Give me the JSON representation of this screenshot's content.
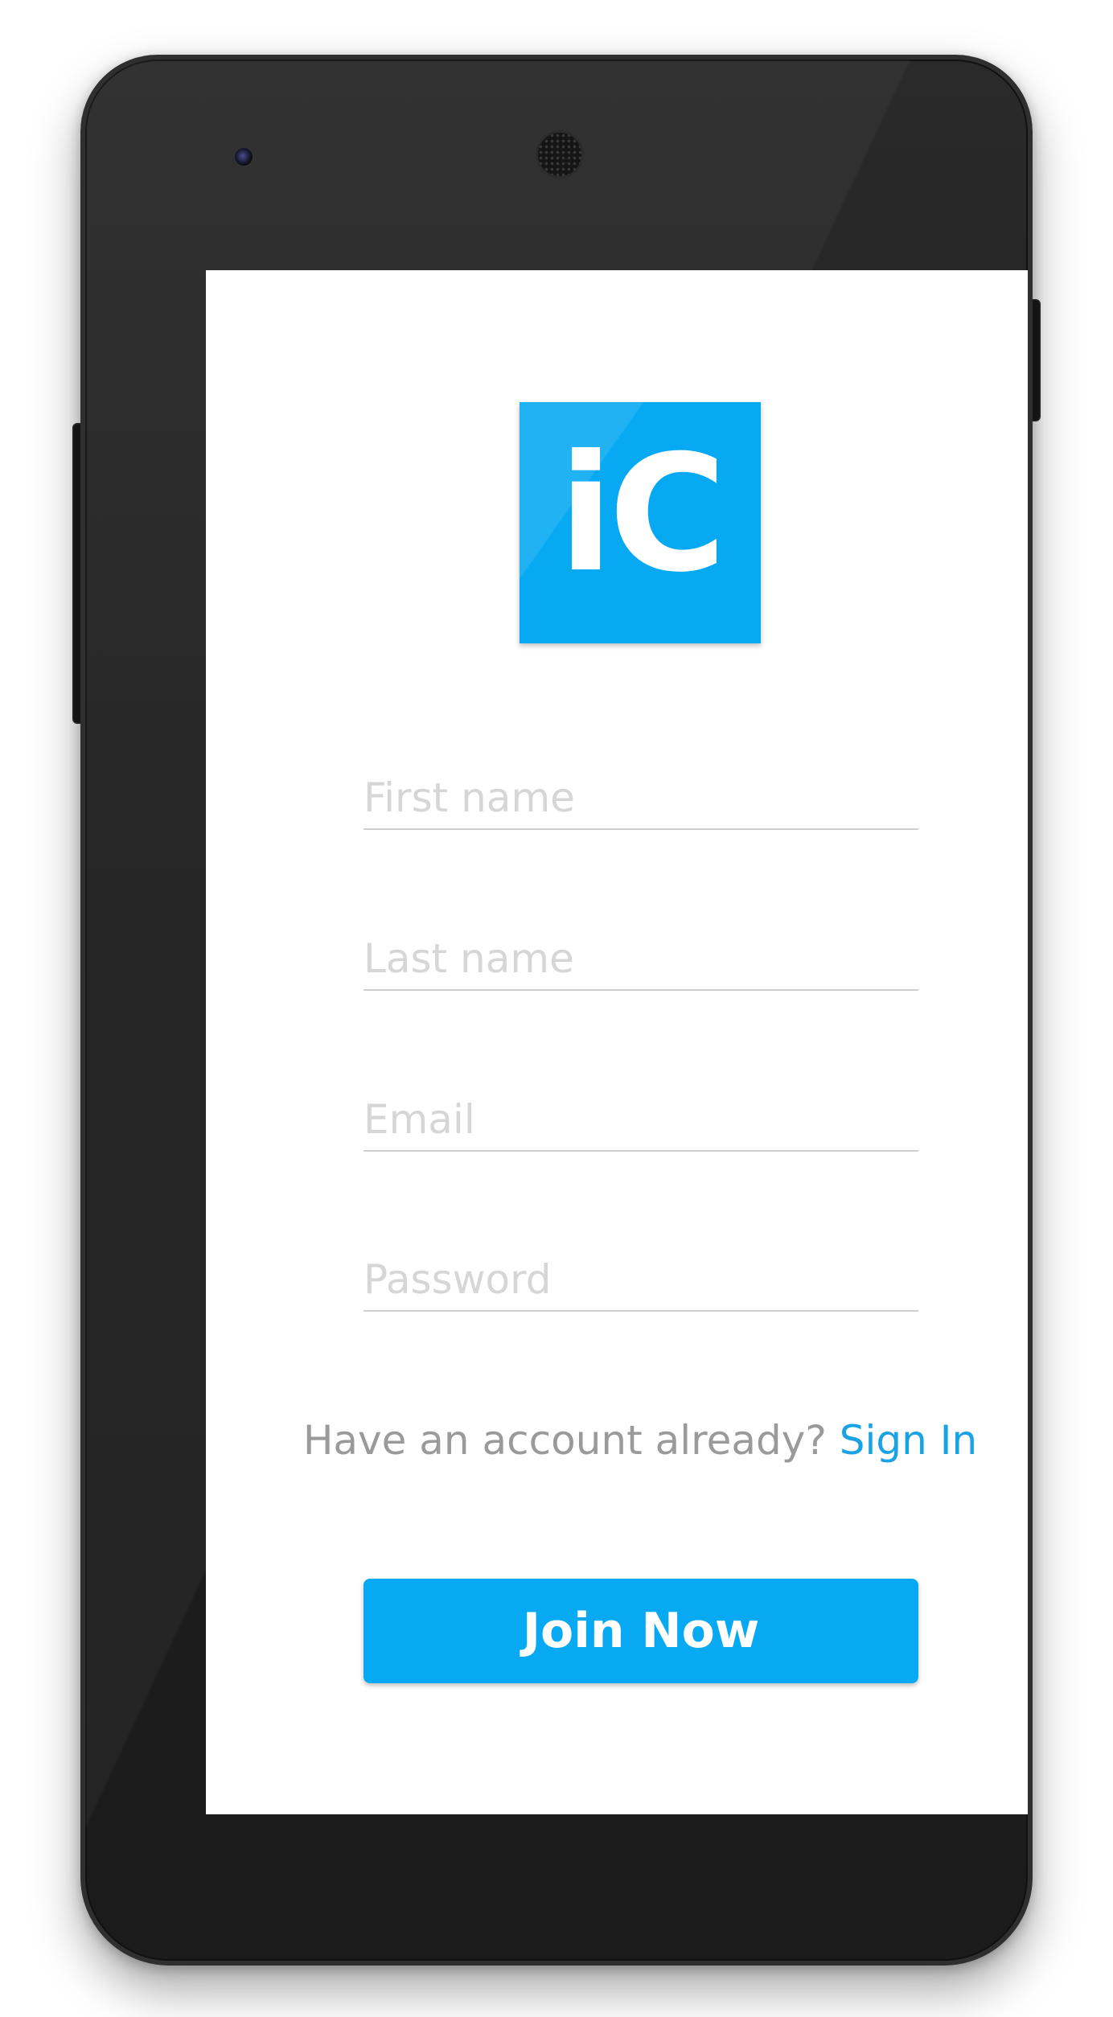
{
  "app": {
    "logo_text": "iC",
    "brand_color": "#07a9f2"
  },
  "form": {
    "first_name": {
      "placeholder": "First name",
      "value": ""
    },
    "last_name": {
      "placeholder": "Last name",
      "value": ""
    },
    "email": {
      "placeholder": "Email",
      "value": ""
    },
    "password": {
      "placeholder": "Password",
      "value": ""
    }
  },
  "account_prompt": {
    "text": "Have an account already?",
    "link_label": "Sign In",
    "link_color": "#1aa3e4"
  },
  "join_button": {
    "label": "Join Now"
  },
  "icons": [
    "front-camera-icon",
    "speaker-grille-icon"
  ]
}
